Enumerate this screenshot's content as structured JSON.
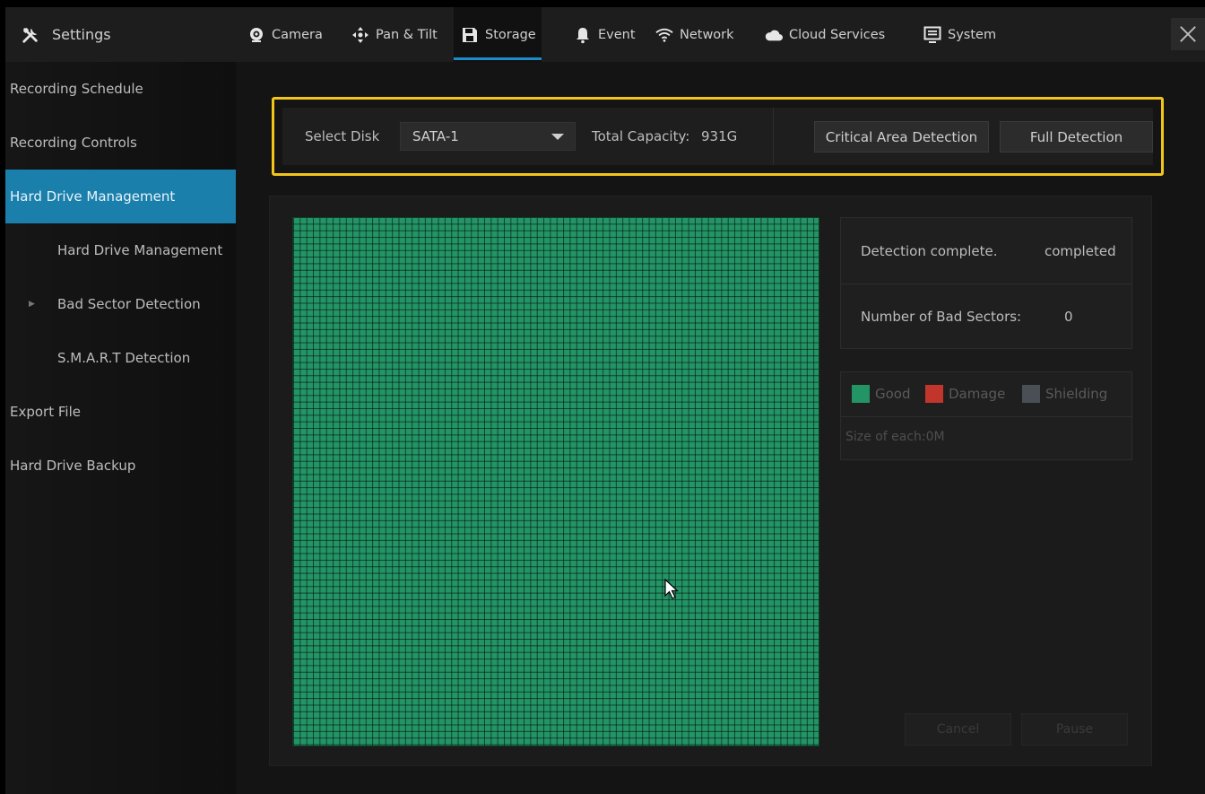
{
  "colors": {
    "accent": "#1c8cc6",
    "sidebar_active": "#1a7fab",
    "highlight_border": "#f2c51a",
    "good": "#239466",
    "damage": "#c2352b",
    "shielding": "#4a4f55"
  },
  "header": {
    "settings_icon": "tools-icon",
    "settings_label": "Settings",
    "tabs": [
      {
        "label": "Camera",
        "icon": "camera-icon"
      },
      {
        "label": "Pan & Tilt",
        "icon": "pan-tilt-icon"
      },
      {
        "label": "Storage",
        "icon": "storage-icon",
        "active": true
      },
      {
        "label": "Event",
        "icon": "bell-icon"
      },
      {
        "label": "Network",
        "icon": "wifi-icon"
      },
      {
        "label": "Cloud Services",
        "icon": "cloud-icon"
      },
      {
        "label": "System",
        "icon": "monitor-icon"
      }
    ],
    "close_icon": "close-icon"
  },
  "sidebar": {
    "items": [
      {
        "label": "Recording Schedule"
      },
      {
        "label": "Recording Controls"
      },
      {
        "label": "Hard Drive Management",
        "active": true
      },
      {
        "label": "Hard Drive Management",
        "sub": true
      },
      {
        "label": "Bad Sector Detection",
        "sub": true,
        "current": true
      },
      {
        "label": "S.M.A.R.T Detection",
        "sub": true
      },
      {
        "label": "Export File"
      },
      {
        "label": "Hard Drive Backup"
      }
    ]
  },
  "toolbar": {
    "select_disk_label": "Select Disk",
    "disk_value": "SATA-1",
    "total_capacity_label": "Total Capacity:",
    "total_capacity_value": "931G",
    "critical_area_button": "Critical Area Detection",
    "full_detection_button": "Full Detection"
  },
  "status": {
    "detection_label": "Detection complete.",
    "detection_value": "completed",
    "bad_sectors_label": "Number of Bad Sectors:",
    "bad_sectors_value": "0"
  },
  "legend": {
    "good": "Good",
    "damage": "Damage",
    "shielding": "Shielding",
    "size_of_each": "Size of each:0M"
  },
  "controls": {
    "cancel": "Cancel",
    "pause": "Pause"
  }
}
